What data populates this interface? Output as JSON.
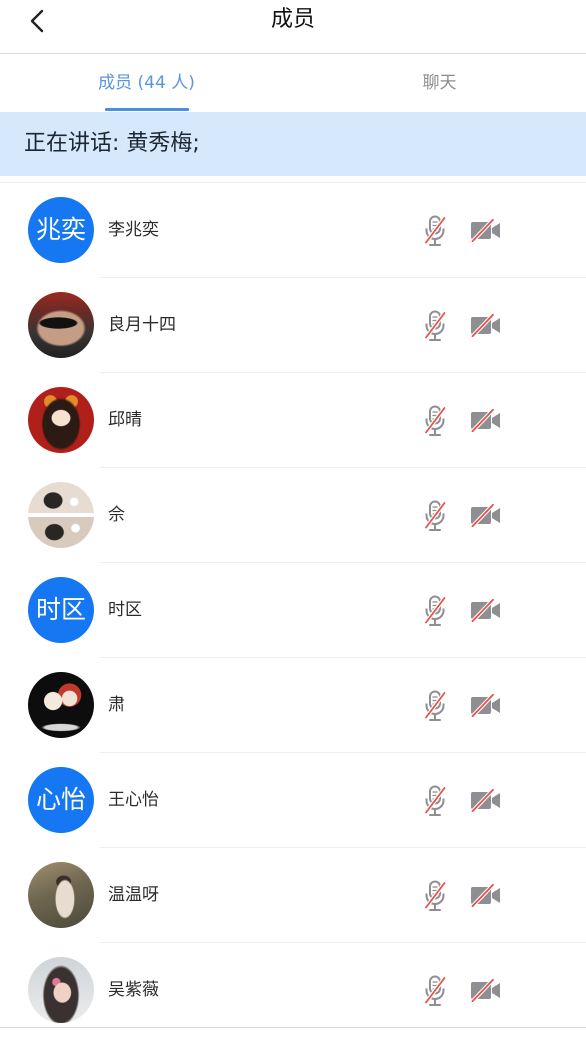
{
  "header": {
    "title": "成员"
  },
  "tabs": [
    {
      "label": "成员 (44 人)",
      "active": true
    },
    {
      "label": "聊天",
      "active": false
    }
  ],
  "speaking_banner": {
    "text": "正在讲话: 黄秀梅;"
  },
  "members": [
    {
      "name": "李兆奕",
      "avatar_text": "兆奕",
      "mic_on": false,
      "video_on": false
    },
    {
      "name": "良月十四",
      "avatar_photo": true,
      "mic_on": false,
      "video_on": false
    },
    {
      "name": "邱晴",
      "avatar_photo": true,
      "mic_on": false,
      "video_on": false
    },
    {
      "name": "佘",
      "avatar_photo": true,
      "mic_on": false,
      "video_on": false
    },
    {
      "name": "时区",
      "avatar_text": "时区",
      "mic_on": false,
      "video_on": false
    },
    {
      "name": "肃",
      "avatar_photo": true,
      "mic_on": false,
      "video_on": false
    },
    {
      "name": "王心怡",
      "avatar_text": "心怡",
      "mic_on": false,
      "video_on": false
    },
    {
      "name": "温温呀",
      "avatar_photo": true,
      "mic_on": false,
      "video_on": false
    },
    {
      "name": "吴紫薇",
      "avatar_photo": true,
      "mic_on": false,
      "video_on": false
    }
  ],
  "icons": {
    "back": "chevron-left-icon",
    "mic_off": "mic-off-icon",
    "video_off": "video-off-icon"
  },
  "colors": {
    "accent": "#4a90e2",
    "tab_active": "#5a95de",
    "avatar_blue": "#1677f2",
    "banner_bg": "#d6e8fb",
    "icon_gray": "#8e8e93",
    "icon_slash": "#e5534b"
  }
}
